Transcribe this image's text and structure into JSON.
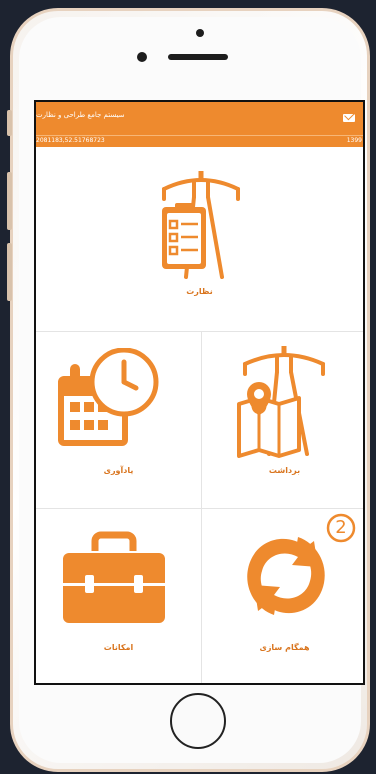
{
  "colors": {
    "accent": "#ee8a2e",
    "accent_dark": "#d9751f",
    "background": "#1d2330"
  },
  "app_bar": {
    "title": "سیستم جامع طراحی و نظارت",
    "coords": "2081183,52.51768723",
    "year": "1399",
    "mail_icon": "mail-icon"
  },
  "menu": {
    "supervision": {
      "label": "نظارت",
      "icon": "tower-clipboard-icon"
    },
    "reminder": {
      "label": "یادآوری",
      "icon": "calendar-clock-icon"
    },
    "harvest": {
      "label": "برداشت",
      "icon": "tower-map-icon"
    },
    "facilities": {
      "label": "امکانات",
      "icon": "toolbox-icon"
    },
    "sync": {
      "label": "همگام سازی",
      "icon": "sync-icon",
      "badge": "2"
    }
  }
}
